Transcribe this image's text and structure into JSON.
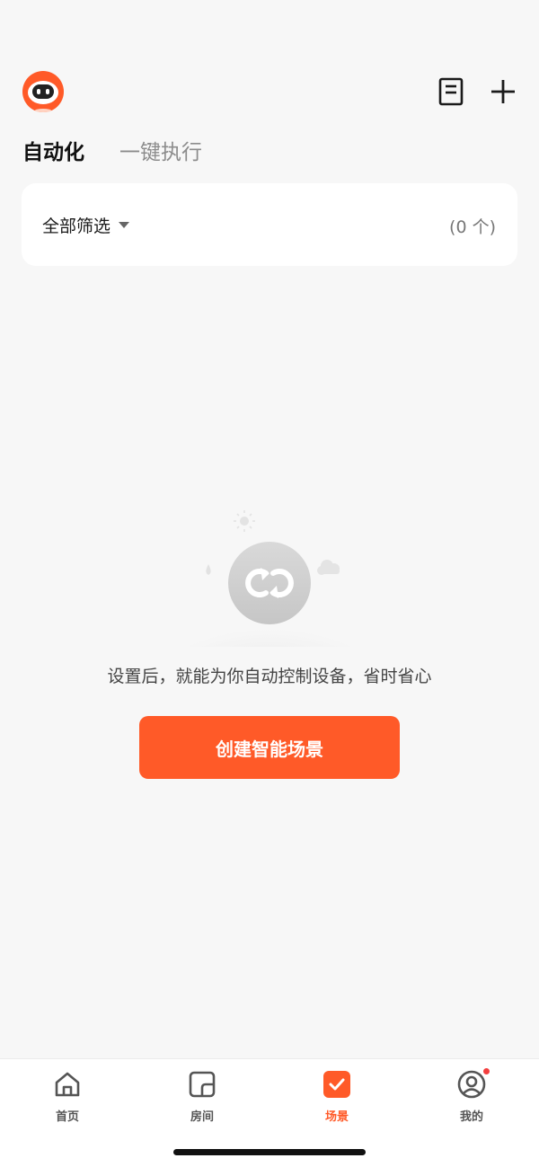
{
  "header": {
    "avatar_icon": "robot-avatar-icon",
    "notes_icon": "notes-icon",
    "add_icon": "plus-icon"
  },
  "tabs": [
    {
      "label": "自动化",
      "active": true
    },
    {
      "label": "一键执行",
      "active": false
    }
  ],
  "filter": {
    "label": "全部筛选",
    "count": "(0 个)"
  },
  "empty_state": {
    "icon": "loop-scene-icon",
    "message": "设置后，就能为你自动控制设备，省时省心",
    "button_label": "创建智能场景"
  },
  "bottom_nav": [
    {
      "label": "首页",
      "icon": "home-icon",
      "active": false
    },
    {
      "label": "房间",
      "icon": "room-icon",
      "active": false
    },
    {
      "label": "场景",
      "icon": "scene-check-icon",
      "active": true
    },
    {
      "label": "我的",
      "icon": "profile-icon",
      "active": false,
      "badge": true
    }
  ],
  "colors": {
    "accent": "#ff5a28",
    "background": "#f7f7f7",
    "badge": "#f33e3e"
  }
}
